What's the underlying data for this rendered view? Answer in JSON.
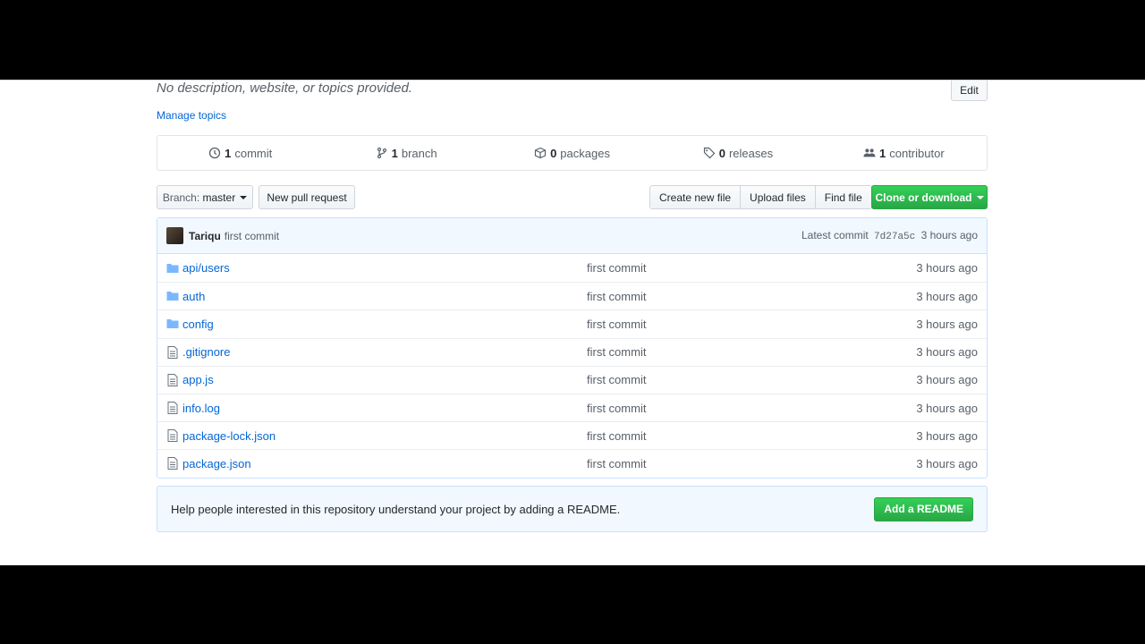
{
  "repo": {
    "description": "No description, website, or topics provided.",
    "edit_label": "Edit",
    "manage_topics": "Manage topics"
  },
  "summary": [
    {
      "icon": "history-icon",
      "count": "1",
      "label": "commit"
    },
    {
      "icon": "branch-icon",
      "count": "1",
      "label": "branch"
    },
    {
      "icon": "package-icon",
      "count": "0",
      "label": "packages"
    },
    {
      "icon": "tag-icon",
      "count": "0",
      "label": "releases"
    },
    {
      "icon": "people-icon",
      "count": "1",
      "label": "contributor"
    }
  ],
  "toolbar": {
    "branch_label": "Branch:",
    "branch_value": "master",
    "new_pull_request": "New pull request",
    "create_new_file": "Create new file",
    "upload_files": "Upload files",
    "find_file": "Find file",
    "clone_or_download": "Clone or download"
  },
  "latest_commit": {
    "author": "Tariqu",
    "message": "first commit",
    "prefix": "Latest commit",
    "sha": "7d27a5c",
    "age": "3 hours ago"
  },
  "files": [
    {
      "type": "dir",
      "name": "api/users",
      "message": "first commit",
      "age": "3 hours ago"
    },
    {
      "type": "dir",
      "name": "auth",
      "message": "first commit",
      "age": "3 hours ago"
    },
    {
      "type": "dir",
      "name": "config",
      "message": "first commit",
      "age": "3 hours ago"
    },
    {
      "type": "file",
      "name": ".gitignore",
      "message": "first commit",
      "age": "3 hours ago"
    },
    {
      "type": "file",
      "name": "app.js",
      "message": "first commit",
      "age": "3 hours ago"
    },
    {
      "type": "file",
      "name": "info.log",
      "message": "first commit",
      "age": "3 hours ago"
    },
    {
      "type": "file",
      "name": "package-lock.json",
      "message": "first commit",
      "age": "3 hours ago"
    },
    {
      "type": "file",
      "name": "package.json",
      "message": "first commit",
      "age": "3 hours ago"
    }
  ],
  "readme": {
    "text": "Help people interested in this repository understand your project by adding a README.",
    "button": "Add a README"
  },
  "colors": {
    "link": "#0366d6",
    "green": "#28a745",
    "folder": "#79b8ff",
    "muted": "#586069"
  }
}
